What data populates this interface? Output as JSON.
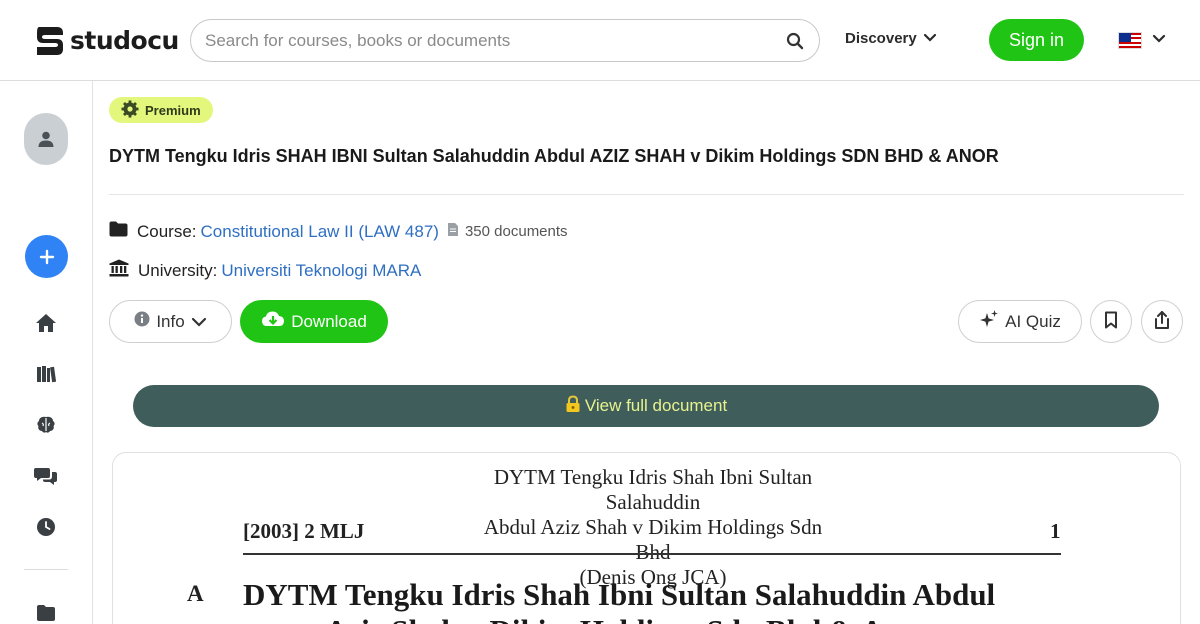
{
  "header": {
    "logo_text": "studocu",
    "search": {
      "placeholder": "Search for courses, books or documents",
      "value": ""
    },
    "discovery_label": "Discovery",
    "signin_label": "Sign in",
    "language_flag": "malaysia-flag-icon"
  },
  "sidebar": {
    "icons": [
      "user-avatar-icon",
      "plus-icon",
      "home-icon",
      "library-icon",
      "brain-icon",
      "chat-icon",
      "clock-icon",
      "folder-icon"
    ]
  },
  "document": {
    "badge": "Premium",
    "title": "DYTM Tengku Idris SHAH IBNI Sultan Salahuddin Abdul AZIZ SHAH v Dikim Holdings SDN BHD & ANOR",
    "course_label": "Course:",
    "course_name": "Constitutional Law II (LAW 487)",
    "course_documents": "350 documents",
    "university_label": "University:",
    "university_name": "Universiti Teknologi MARA"
  },
  "actions": {
    "info_label": "Info",
    "download_label": "Download",
    "ai_quiz_label": "AI Quiz",
    "view_full_label": "View full document"
  },
  "preview": {
    "header_line1": "DYTM Tengku Idris Shah Ibni Sultan Salahuddin",
    "header_line2": "Abdul Aziz Shah v Dikim Holdings Sdn Bhd",
    "header_line3": "(Denis Ong JCA)",
    "citation": "[2003] 2 MLJ",
    "page_number": "1",
    "margin_marker": "A",
    "body_title_line1": "DYTM Tengku Idris Shah Ibni Sultan Salahuddin Abdul",
    "body_title_line2": "Aziz Shah v Dikim Holdings Sdn Bhd & Anor"
  },
  "colors": {
    "brand_green": "#20c414",
    "premium_bg": "#e3f77d",
    "link_blue": "#2f6fc2",
    "view_full_bg": "#3f5d5b",
    "view_full_text": "#e6f28d",
    "add_button": "#2f83f5"
  }
}
